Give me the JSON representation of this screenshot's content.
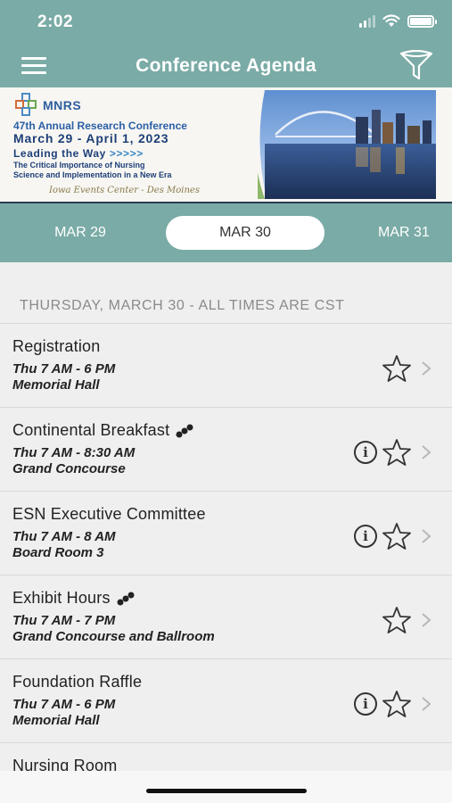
{
  "status": {
    "time": "2:02"
  },
  "nav": {
    "title": "Conference Agenda"
  },
  "banner": {
    "logo_text": "MNRS",
    "line1": "47th Annual Research Conference",
    "line2": "March 29 - April 1, 2023",
    "line3": "Leading the Way",
    "line3_chevrons": ">>>>>",
    "sub1": "The Critical Importance of Nursing",
    "sub2": "Science and Implementation in a New Era",
    "venue": "Iowa Events Center - Des Moines"
  },
  "dates": {
    "prev": "MAR 29",
    "active": "MAR 30",
    "next": "MAR 31"
  },
  "section_header": "THURSDAY, MARCH 30 - ALL TIMES ARE CST",
  "sessions": [
    {
      "title": "Registration",
      "time": "Thu 7 AM - 6 PM",
      "location": "Memorial Hall"
    },
    {
      "title": "Continental Breakfast",
      "time": "Thu 7 AM - 8:30 AM",
      "location": "Grand Concourse"
    },
    {
      "title": "ESN Executive Committee",
      "time": "Thu 7 AM - 8 AM",
      "location": "Board Room 3"
    },
    {
      "title": "Exhibit Hours",
      "time": "Thu 7 AM - 7 PM",
      "location": "Grand Concourse and Ballroom"
    },
    {
      "title": "Foundation Raffle",
      "time": "Thu 7 AM - 6 PM",
      "location": "Memorial Hall"
    },
    {
      "title": "Nursing Room",
      "time": "",
      "location": ""
    }
  ],
  "icons": {
    "info": "i",
    "star": "star-outline-icon",
    "chevron": "chevron-right-icon",
    "link": "link-icon"
  },
  "colors": {
    "accent": "#7aaba6",
    "banner_blue": "#1e3f78"
  }
}
